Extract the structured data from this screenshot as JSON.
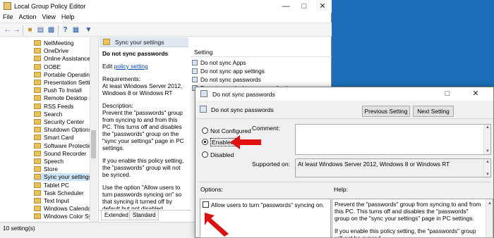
{
  "main": {
    "title": "Local Group Policy Editor",
    "menu": [
      "File",
      "Action",
      "View",
      "Help"
    ],
    "tree_items": [
      "NetMeeting",
      "OneDrive",
      "Online Assistance",
      "OOBE",
      "Portable Operating",
      "Presentation Setti",
      "Push To Install",
      "Remote Desktop Se",
      "RSS Feeds",
      "Search",
      "Security Center",
      "Shutdown Options",
      "Smart Card",
      "Software Protectio",
      "Sound Recorder",
      "Speech",
      "Store",
      "Sync your settings",
      "Tablet PC",
      "Task Scheduler",
      "Text Input",
      "Windows Calendar",
      "Windows Color Sys"
    ],
    "selected_tree_item": "Sync your settings",
    "desc_header": "Sync your settings",
    "desc_title": "Do not sync passwords",
    "desc_edit_prefix": "Edit ",
    "desc_edit_link": "policy setting",
    "desc_requirements": "Requirements:\nAt least Windows Server 2012, Windows 8 or Windows RT",
    "desc_description": "Description:\nPrevent the \"passwords\" group from syncing to and from this PC. This turns off and disables the \"passwords\" group on the \"sync your settings\" page in PC settings.",
    "desc_p2": "If you enable this policy setting, the \"passwords\" group will not be synced.",
    "desc_p3": "Use the option \"Allow users to turn passwords syncing on\" so that syncing it turned off by default but not disabled.",
    "tabs": [
      "Extended",
      "Standard"
    ],
    "settings_header": "Setting",
    "settings_items": [
      "Do not sync Apps",
      "Do not sync app settings",
      "Do not sync passwords",
      "Do not sync desktop personalization"
    ],
    "status": "10 setting(s)"
  },
  "dialog": {
    "title": "Do not sync passwords",
    "header_label": "Do not sync passwords",
    "prev_button": "Previous Setting",
    "next_button": "Next Setting",
    "radios": [
      "Not Configured",
      "Enabled",
      "Disabled"
    ],
    "selected_radio": "Enabled",
    "comment_label": "Comment:",
    "supported_label": "Supported on:",
    "supported_value": "At least Windows Server 2012, Windows 8 or Windows RT",
    "options_label": "Options:",
    "help_label": "Help:",
    "option_checkbox": "Allow users to turn \"passwords\" syncing on.",
    "help_p1": "Prevent the \"passwords\" group from syncing to and from this PC.  This turns off and disables the \"passwords\" group on the \"sync your settings\" page in PC settings.",
    "help_p2": "If you enable this policy setting, the \"passwords\" group will not be synced."
  },
  "colors": {
    "accent": "#1a6fb8",
    "annotation_red": "#e01010",
    "selection": "#cce4f7"
  },
  "icons": [
    "app-icon",
    "back-icon",
    "forward-icon",
    "folder-icon",
    "properties-icon",
    "help-icon",
    "filter-icon",
    "policy-icon"
  ]
}
